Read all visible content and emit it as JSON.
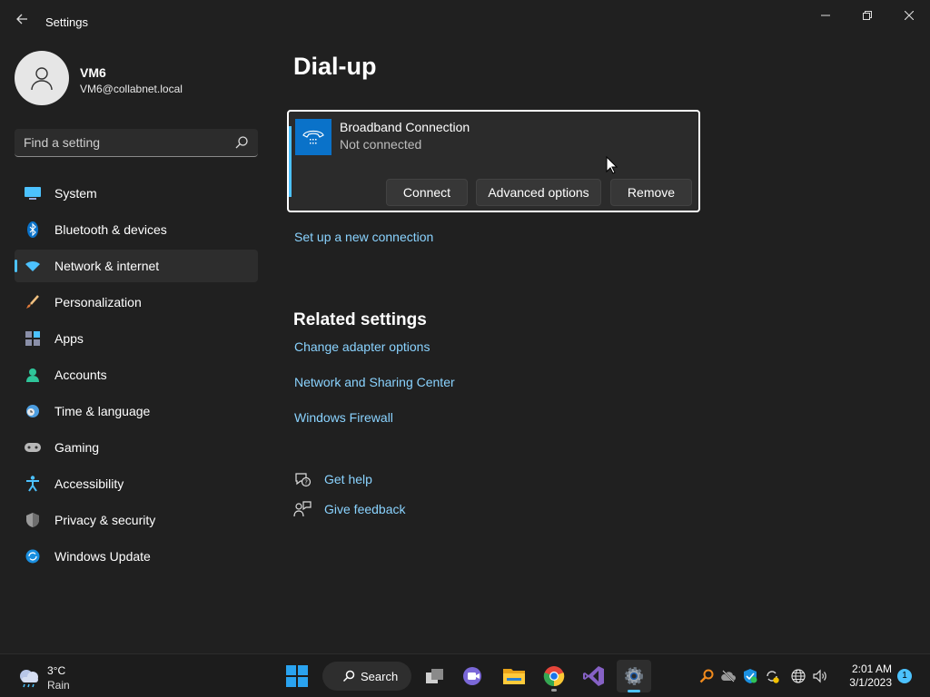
{
  "window": {
    "title": "Settings",
    "back_glyph": "←",
    "controls": {
      "minimize": "minimize-icon",
      "maximize": "restore-icon",
      "close": "close-icon"
    }
  },
  "profile": {
    "name": "VM6",
    "email": "VM6@collabnet.local"
  },
  "search": {
    "placeholder": "Find a setting"
  },
  "sidebar": {
    "items": [
      {
        "label": "System",
        "icon": "system-icon"
      },
      {
        "label": "Bluetooth & devices",
        "icon": "bluetooth-icon"
      },
      {
        "label": "Network & internet",
        "icon": "wifi-icon",
        "active": true
      },
      {
        "label": "Personalization",
        "icon": "brush-icon"
      },
      {
        "label": "Apps",
        "icon": "apps-icon"
      },
      {
        "label": "Accounts",
        "icon": "accounts-icon"
      },
      {
        "label": "Time & language",
        "icon": "clock-globe-icon"
      },
      {
        "label": "Gaming",
        "icon": "gamepad-icon"
      },
      {
        "label": "Accessibility",
        "icon": "accessibility-icon"
      },
      {
        "label": "Privacy & security",
        "icon": "shield-icon"
      },
      {
        "label": "Windows Update",
        "icon": "update-icon"
      }
    ]
  },
  "main": {
    "title": "Dial-up",
    "connection": {
      "name": "Broadband Connection",
      "status": "Not connected",
      "buttons": {
        "connect": "Connect",
        "advanced": "Advanced options",
        "remove": "Remove"
      }
    },
    "setup_link": "Set up a new connection",
    "related": {
      "title": "Related settings",
      "links": [
        "Change adapter options",
        "Network and Sharing Center",
        "Windows Firewall"
      ]
    },
    "help": {
      "get_help": "Get help",
      "give_feedback": "Give feedback"
    }
  },
  "taskbar": {
    "weather": {
      "temp": "3°C",
      "condition": "Rain"
    },
    "search_label": "Search",
    "clock": {
      "time": "2:01 AM",
      "date": "3/1/2023"
    },
    "notification_count": "1"
  },
  "colors": {
    "accent": "#4cc2ff",
    "link": "#8ad3ff",
    "background": "#202020",
    "card": "#2b2b2b"
  }
}
